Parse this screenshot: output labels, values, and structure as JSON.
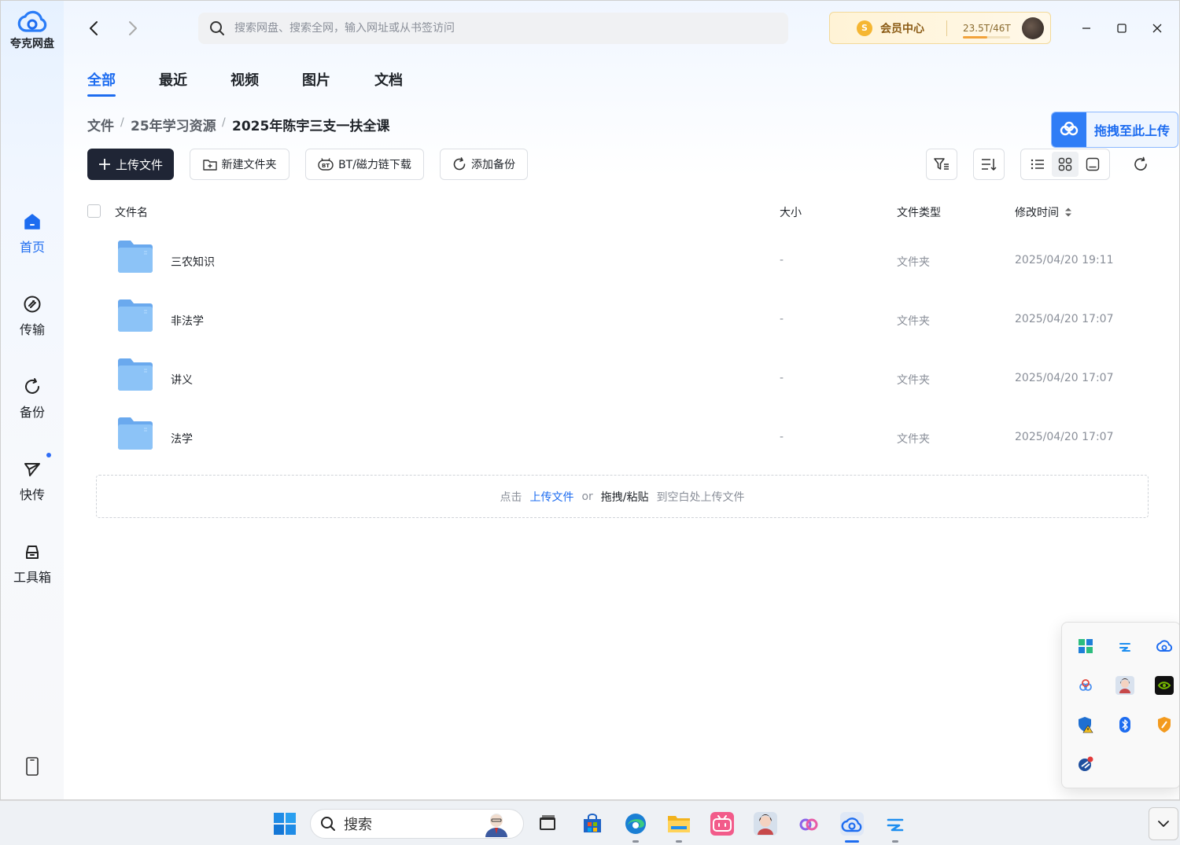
{
  "app": {
    "name": "夸克网盘",
    "brand_color": "#1d6cf0"
  },
  "sidebar": {
    "items": [
      {
        "label": "首页",
        "icon": "home-icon",
        "active": true
      },
      {
        "label": "传输",
        "icon": "transfer-icon",
        "active": false
      },
      {
        "label": "备份",
        "icon": "backup-icon",
        "active": false
      },
      {
        "label": "快传",
        "icon": "quick-send-icon",
        "active": false,
        "has_dot": true
      },
      {
        "label": "工具箱",
        "icon": "toolbox-icon",
        "active": false
      }
    ],
    "bottom_icon": "phone-icon"
  },
  "topbar": {
    "search_placeholder": "搜索网盘、搜索全网，输入网址或从书签访问",
    "vip_label": "会员中心",
    "vip_coin": "S",
    "storage_text": "23.5T/46T",
    "storage_fraction": 0.51
  },
  "tabs": [
    {
      "label": "全部",
      "active": true
    },
    {
      "label": "最近",
      "active": false
    },
    {
      "label": "视频",
      "active": false
    },
    {
      "label": "图片",
      "active": false
    },
    {
      "label": "文档",
      "active": false
    }
  ],
  "breadcrumb": {
    "items": [
      "文件",
      "25年学习资源",
      "2025年陈宇三支一扶全课"
    ],
    "separator": "/"
  },
  "toolbar": {
    "upload": "上传文件",
    "new_folder": "新建文件夹",
    "bt_download": "BT/磁力链下载",
    "add_backup": "添加备份"
  },
  "drag_upload": {
    "label": "拖拽至此上传"
  },
  "table": {
    "headers": {
      "name": "文件名",
      "size": "大小",
      "type": "文件类型",
      "modified": "修改时间"
    },
    "rows": [
      {
        "name": "三农知识",
        "size": "-",
        "type": "文件夹",
        "modified": "2025/04/20 19:11"
      },
      {
        "name": "非法学",
        "size": "-",
        "type": "文件夹",
        "modified": "2025/04/20 17:07"
      },
      {
        "name": "讲义",
        "size": "-",
        "type": "文件夹",
        "modified": "2025/04/20 17:07"
      },
      {
        "name": "法学",
        "size": "-",
        "type": "文件夹",
        "modified": "2025/04/20 17:07"
      }
    ]
  },
  "dropzone": {
    "prefix": "点击",
    "link": "上传文件",
    "or": "or",
    "drag": "拖拽/粘贴",
    "suffix": "到空白处上传文件"
  },
  "taskbar": {
    "search_label": "搜索"
  }
}
